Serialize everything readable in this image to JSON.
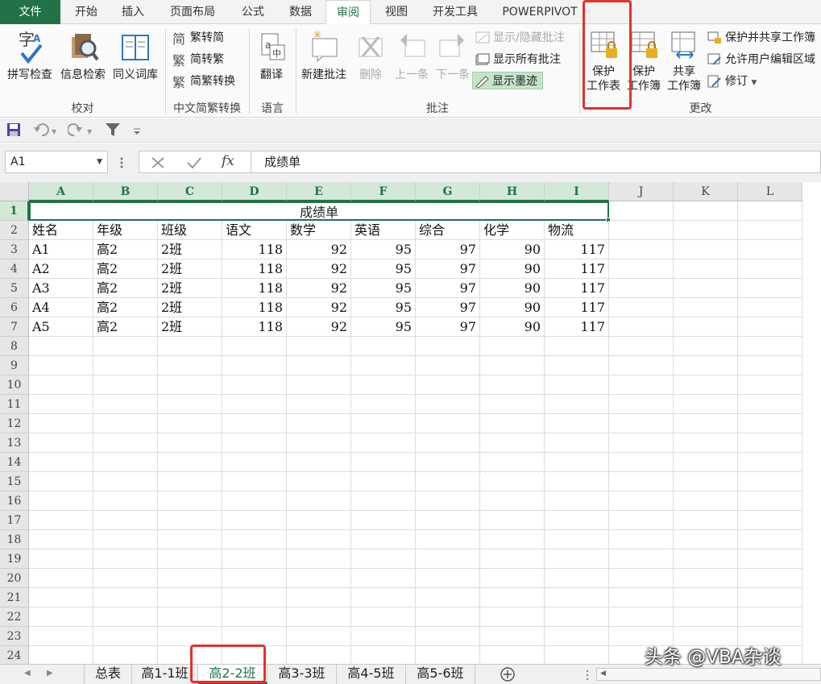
{
  "ribbon_tabs": [
    "文件",
    "开始",
    "插入",
    "页面布局",
    "公式",
    "数据",
    "审阅",
    "视图",
    "开发工具",
    "POWERPIVOT"
  ],
  "active_tab": "审阅",
  "groups": {
    "proofing": {
      "label": "校对",
      "spell": "拼写检查",
      "research": "信息检索",
      "thesaurus": "同义词库"
    },
    "chinese": {
      "label": "中文简繁转换",
      "t2s": "繁转简",
      "s2t": "简转繁",
      "convert": "简繁转换"
    },
    "language": {
      "label": "语言",
      "translate": "翻译"
    },
    "comments": {
      "label": "批注",
      "new": "新建批注",
      "delete": "删除",
      "prev": "上一条",
      "next": "下一条",
      "showhide": "显示/隐藏批注",
      "showall": "显示所有批注",
      "ink": "显示墨迹"
    },
    "changes": {
      "label": "更改",
      "protect_sheet_1": "保护",
      "protect_sheet_2": "工作表",
      "protect_wb_1": "保护",
      "protect_wb_2": "工作簿",
      "share_wb_1": "共享",
      "share_wb_2": "工作簿",
      "protect_share": "保护并共享工作簿",
      "allow_edit": "允许用户编辑区域",
      "track": "修订"
    }
  },
  "namebox": "A1",
  "formula": "成绩单",
  "columns": [
    "A",
    "B",
    "C",
    "D",
    "E",
    "F",
    "G",
    "H",
    "I",
    "J",
    "K",
    "L"
  ],
  "rows": [
    "1",
    "2",
    "3",
    "4",
    "5",
    "6",
    "7",
    "8",
    "9",
    "10",
    "11",
    "12",
    "13",
    "14",
    "15",
    "16",
    "17",
    "18",
    "19",
    "20",
    "21",
    "22",
    "23",
    "24"
  ],
  "title_cell": "成绩单",
  "headers": [
    "姓名",
    "年级",
    "班级",
    "语文",
    "数学",
    "英语",
    "综合",
    "化学",
    "物流"
  ],
  "data": [
    [
      "A1",
      "高2",
      "2班",
      "118",
      "92",
      "95",
      "97",
      "90",
      "117"
    ],
    [
      "A2",
      "高2",
      "2班",
      "118",
      "92",
      "95",
      "97",
      "90",
      "117"
    ],
    [
      "A3",
      "高2",
      "2班",
      "118",
      "92",
      "95",
      "97",
      "90",
      "117"
    ],
    [
      "A4",
      "高2",
      "2班",
      "118",
      "92",
      "95",
      "97",
      "90",
      "117"
    ],
    [
      "A5",
      "高2",
      "2班",
      "118",
      "92",
      "95",
      "97",
      "90",
      "117"
    ]
  ],
  "sheets": [
    "总表",
    "高1-1班",
    "高2-2班",
    "高3-3班",
    "高4-5班",
    "高5-6班"
  ],
  "active_sheet": "高2-2班",
  "watermark": "头条 @VBA杂谈",
  "colors": {
    "accent": "#217346",
    "highlight": "#e5312b"
  }
}
